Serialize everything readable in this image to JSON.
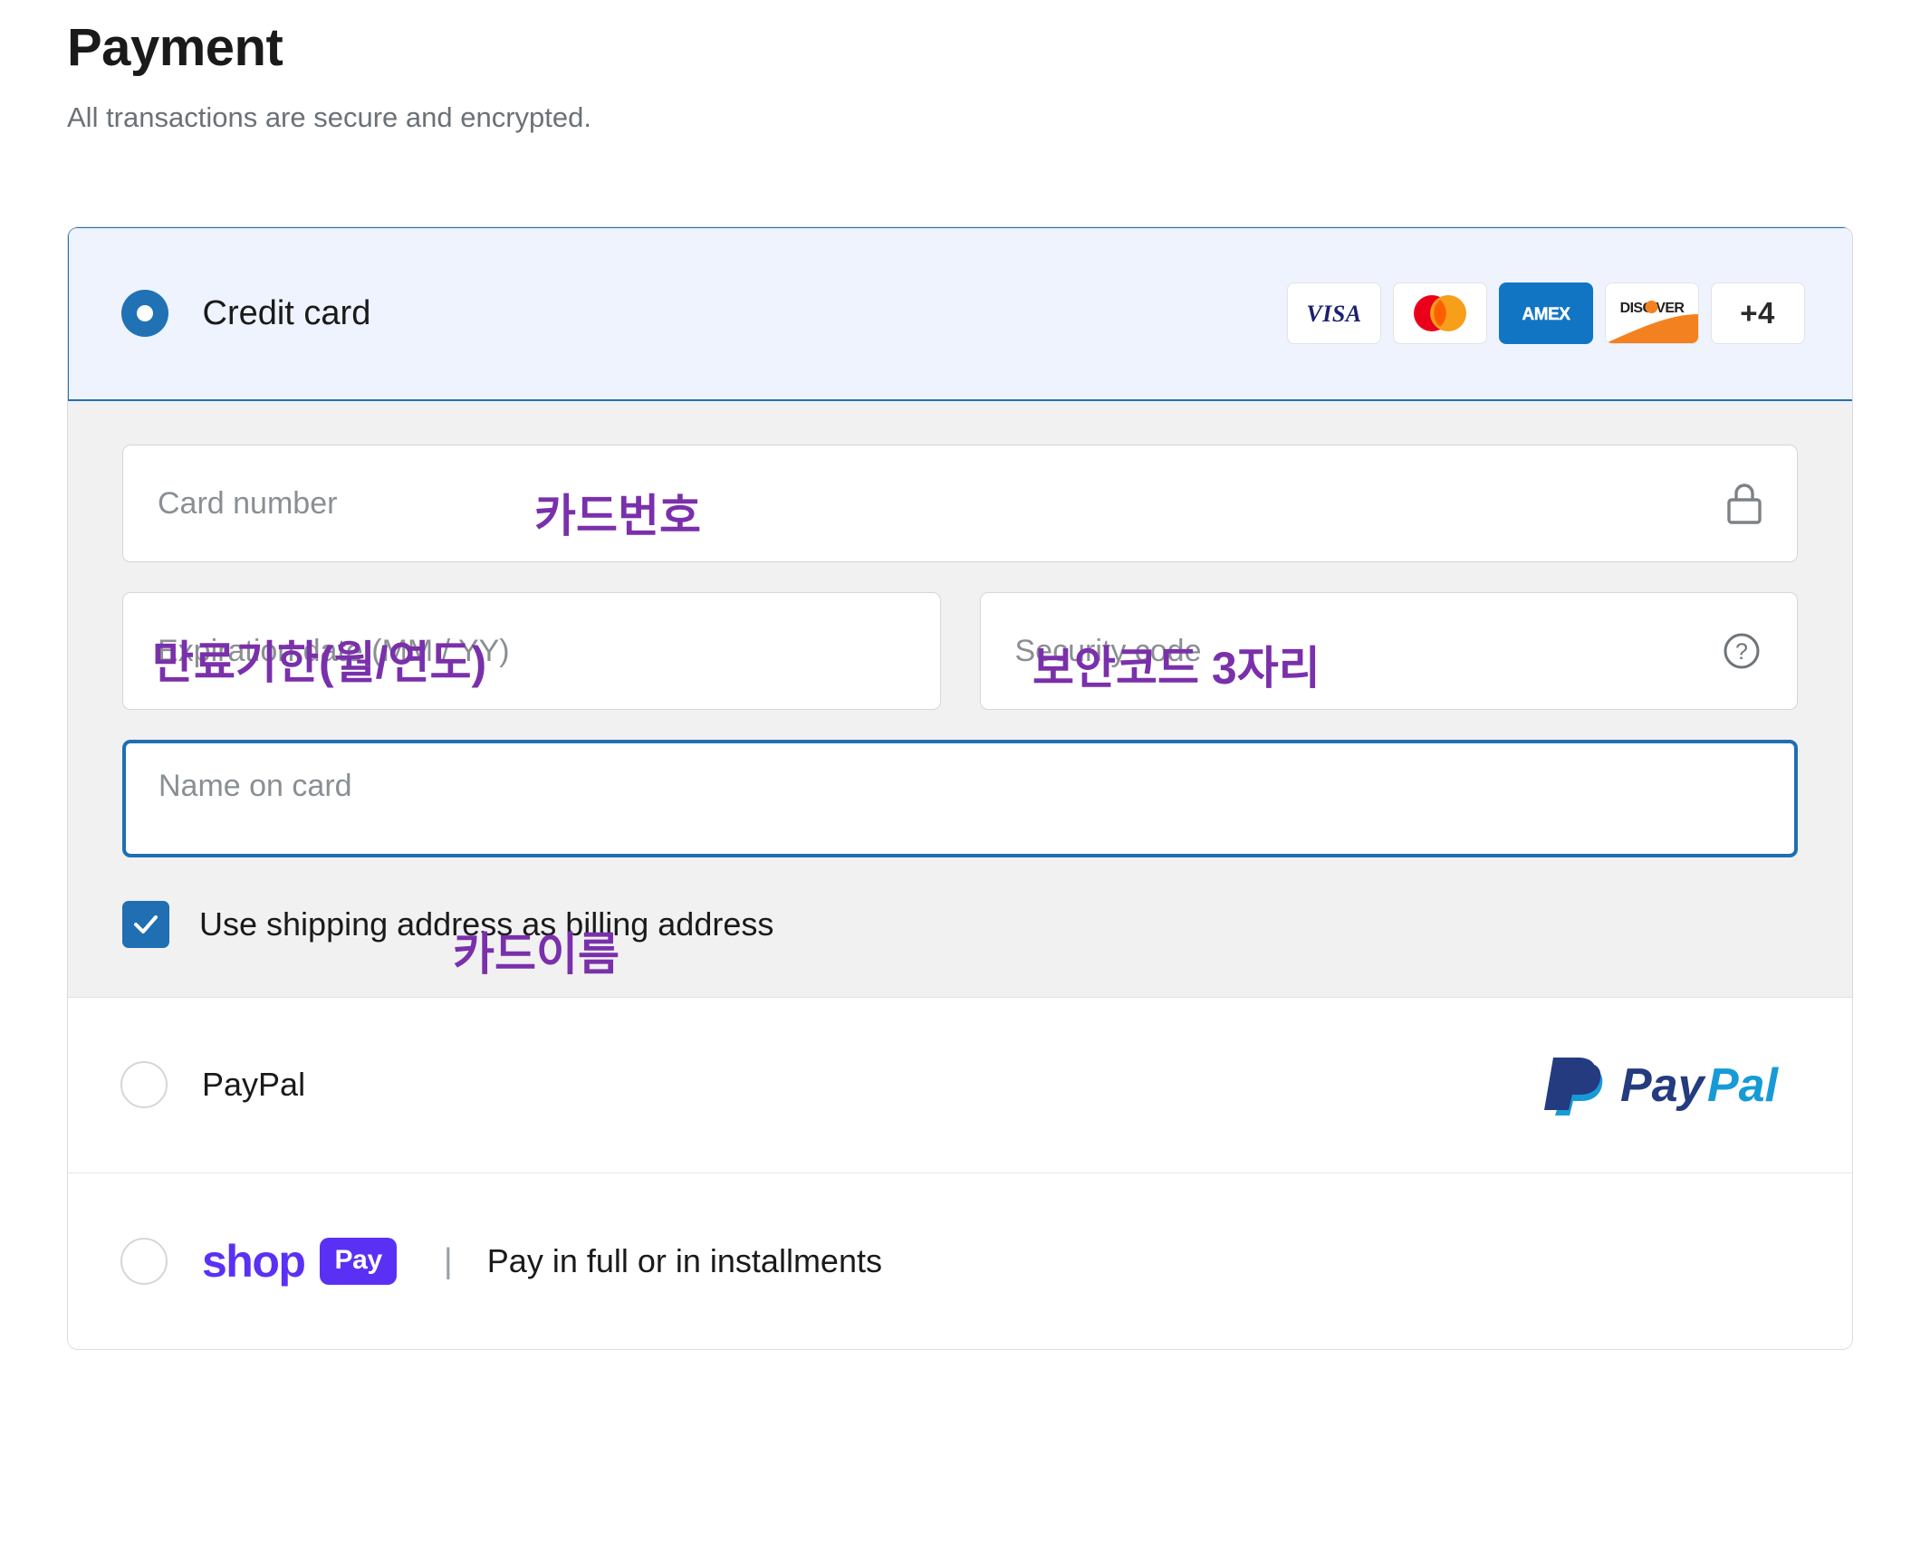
{
  "header": {
    "title": "Payment",
    "subtitle": "All transactions are secure and encrypted."
  },
  "colors": {
    "accent_blue": "#2171b5",
    "selected_bg": "#eef3fd",
    "form_bg": "#f1f1f1",
    "annotation_purple": "#7a30ab",
    "shoppay_purple": "#5a31f4",
    "paypal_dark": "#253b80",
    "paypal_light": "#179bd7"
  },
  "payment_methods": [
    {
      "id": "credit-card",
      "label": "Credit card",
      "selected": true,
      "brands": [
        {
          "name": "visa-logo",
          "label": "VISA"
        },
        {
          "name": "mastercard-logo",
          "label": "Mastercard"
        },
        {
          "name": "amex-logo",
          "label": "AMEX"
        },
        {
          "name": "discover-logo",
          "label": "DISCOVER"
        },
        {
          "name": "more-brands-badge",
          "label": "+4"
        }
      ]
    },
    {
      "id": "paypal",
      "label": "PayPal",
      "selected": false,
      "logo": "paypal-logo"
    },
    {
      "id": "shop-pay",
      "label": "Shop Pay",
      "selected": false,
      "logo_word": "shop",
      "logo_chip": "Pay",
      "divider": "|",
      "tagline": "Pay in full or in installments"
    }
  ],
  "card_form": {
    "card_number": {
      "placeholder": "Card number",
      "value": "",
      "icon": "lock-icon",
      "annotation": "카드번호"
    },
    "expiration": {
      "placeholder": "Expiration date (MM / YY)",
      "value": "",
      "annotation": "만료기한(월/연도)"
    },
    "security_code": {
      "placeholder": "Security code",
      "value": "",
      "icon": "help-question-icon",
      "annotation": "보안코드 3자리"
    },
    "name_on_card": {
      "placeholder": "Name on card",
      "value": "",
      "focused": true,
      "annotation": "카드이름"
    },
    "billing_checkbox": {
      "label": "Use shipping address as billing address",
      "checked": true
    }
  }
}
